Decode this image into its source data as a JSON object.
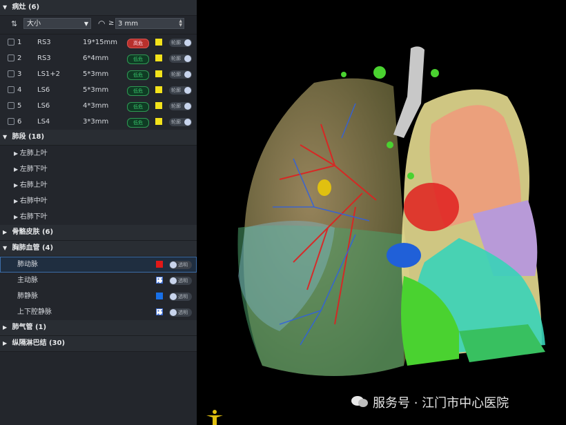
{
  "lesions": {
    "header": "病灶 (6)",
    "sort_select": "大小",
    "filter_ge": "≥",
    "filter_value": "3 mm",
    "items": [
      {
        "index": "1",
        "location": "RS3",
        "size": "19*15mm",
        "risk": "高危",
        "risk_level": "high",
        "outline": "轮廓"
      },
      {
        "index": "2",
        "location": "RS3",
        "size": "6*4mm",
        "risk": "低危",
        "risk_level": "low",
        "outline": "轮廓"
      },
      {
        "index": "3",
        "location": "LS1+2",
        "size": "5*3mm",
        "risk": "低危",
        "risk_level": "low",
        "outline": "轮廓"
      },
      {
        "index": "4",
        "location": "LS6",
        "size": "5*3mm",
        "risk": "低危",
        "risk_level": "low",
        "outline": "轮廓"
      },
      {
        "index": "5",
        "location": "LS6",
        "size": "4*3mm",
        "risk": "低危",
        "risk_level": "low",
        "outline": "轮廓"
      },
      {
        "index": "6",
        "location": "LS4",
        "size": "3*3mm",
        "risk": "低危",
        "risk_level": "low",
        "outline": "轮廓"
      }
    ]
  },
  "segments": {
    "header": "肺段 (18)",
    "items": [
      "左肺上叶",
      "左肺下叶",
      "右肺上叶",
      "右肺中叶",
      "右肺下叶"
    ]
  },
  "bone_skin": {
    "header": "骨骼皮肤 (6)"
  },
  "vessels": {
    "header": "胸肺血管 (4)",
    "items": [
      {
        "name": "肺动脉",
        "toggle": "透明"
      },
      {
        "name": "主动脉",
        "toggle": "透明"
      },
      {
        "name": "肺静脉",
        "toggle": "透明"
      },
      {
        "name": "上下腔静脉",
        "toggle": "透明"
      }
    ]
  },
  "trachea": {
    "header": "肺气管 (1)"
  },
  "lymph": {
    "header": "纵隔淋巴结 (30)"
  },
  "watermark": "服务号 · 江门市中心医院",
  "colors": {
    "panel": "#23262c",
    "high_risk": "#b8302c",
    "low_risk": "#2f9a54",
    "lesion_marker": "#f3e21b",
    "artery": "#e01818",
    "vein": "#1870e8"
  }
}
